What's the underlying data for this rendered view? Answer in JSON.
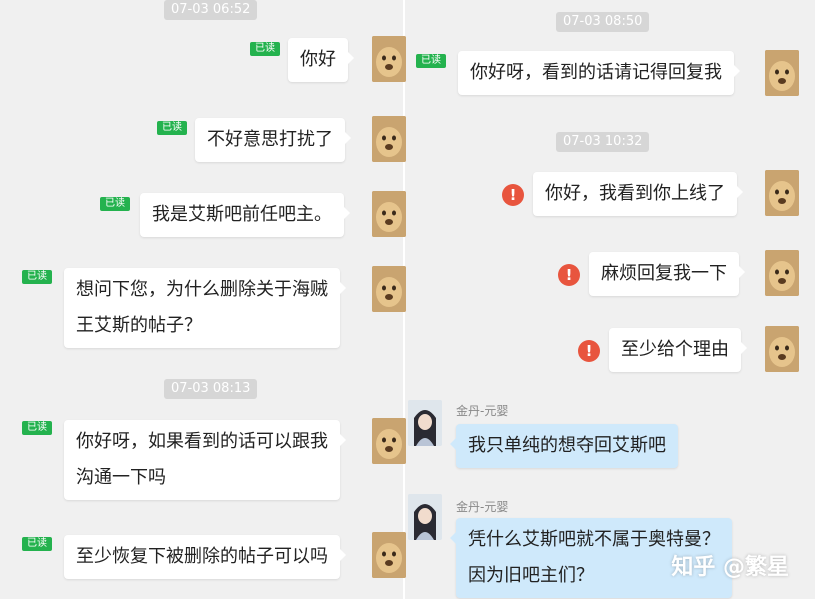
{
  "read_label": "已读",
  "left_column": {
    "timestamps": [
      "07-03 06:52",
      "07-03 08:13"
    ],
    "messages": [
      "你好",
      "不好意思打扰了",
      "我是艾斯吧前任吧主。",
      "想问下您，为什么删除关于海贼",
      "王艾斯的帖子？",
      "你好呀，如果看到的话可以跟我",
      "沟通一下吗",
      "至少恢复下被删除的帖子可以吗"
    ]
  },
  "right_column": {
    "timestamps": [
      "07-03 08:50",
      "07-03 10:32"
    ],
    "sent_messages": [
      "你好呀，看到的话请记得回复我",
      "你好，我看到你上线了",
      "麻烦回复我一下",
      "至少给个理由"
    ],
    "error_symbol": "!",
    "replies": [
      {
        "sender": "金丹-元婴",
        "lines": [
          "我只单纯的想夺回艾斯吧"
        ]
      },
      {
        "sender": "金丹-元婴",
        "lines": [
          "凭什么艾斯吧就不属于奥特曼？",
          "因为旧吧主们？"
        ]
      }
    ]
  },
  "watermark": "知乎 @繁星",
  "colors": {
    "background": "#f0f0f0",
    "read_badge": "#24b24e",
    "error_icon": "#e8553e",
    "reply_bubble": "#cfe9fb",
    "timestamp_bg": "#d6d6d6"
  }
}
